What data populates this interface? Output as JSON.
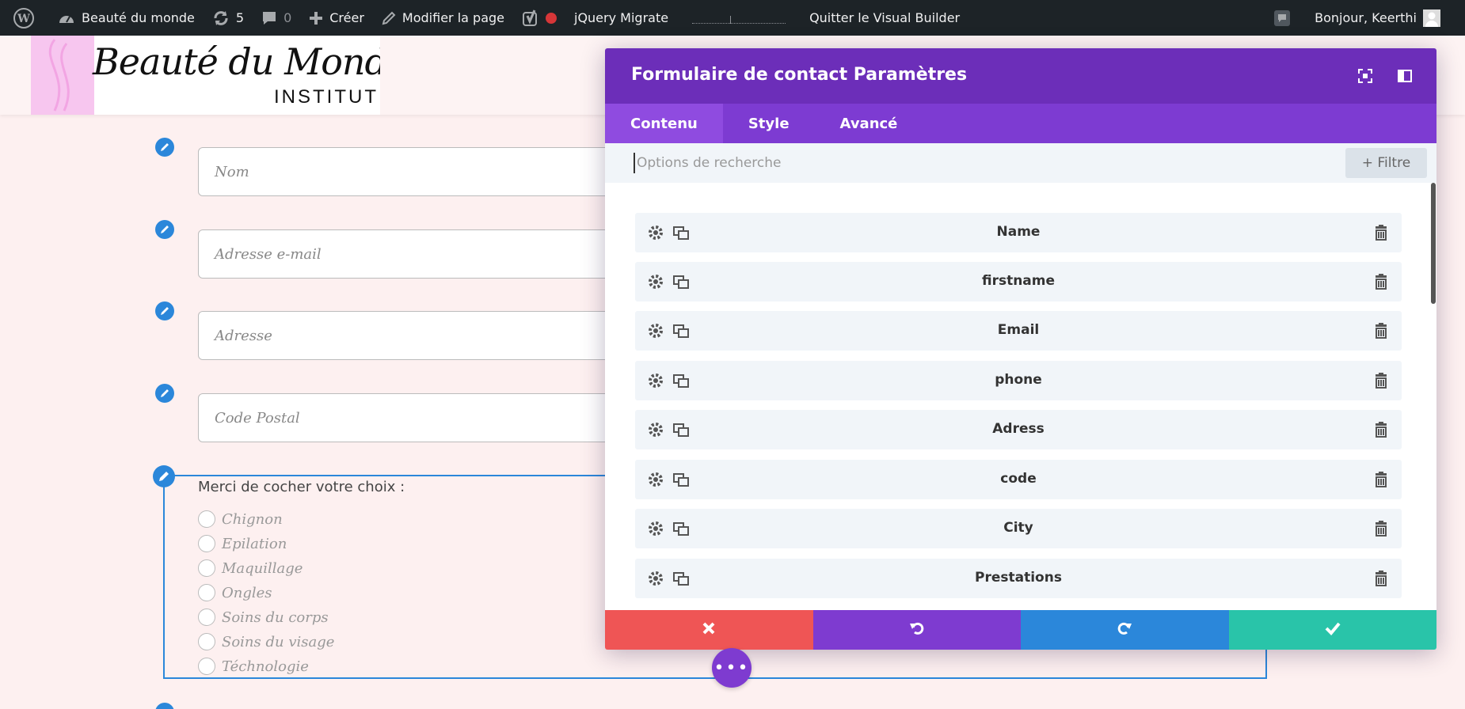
{
  "admin_bar": {
    "site_name": "Beauté du monde",
    "updates_count": "5",
    "comments_count": "0",
    "new_label": "Créer",
    "edit_label": "Modifier la page",
    "jquery_label": "jQuery Migrate",
    "exit_label": "Quitter le Visual Builder",
    "greeting": "Bonjour, Keerthi"
  },
  "logo": {
    "script_text": "Beauté du Monde",
    "sub_text": "INSTITUT"
  },
  "form": {
    "fields": [
      {
        "placeholder": "Nom"
      },
      {
        "placeholder": "Adresse e-mail"
      },
      {
        "placeholder": "Adresse"
      },
      {
        "placeholder": "Code Postal"
      }
    ],
    "choice_title": "Merci de cocher votre choix :",
    "options": [
      "Chignon",
      "Epilation",
      "Maquillage",
      "Ongles",
      "Soins du corps",
      "Soins du visage",
      "Téchnologie"
    ]
  },
  "modal": {
    "title": "Formulaire de contact Paramètres",
    "tabs": [
      "Contenu",
      "Style",
      "Avancé"
    ],
    "active_tab": "Contenu",
    "search_placeholder": "Options de recherche",
    "filter_label": "+ Filtre",
    "fields": [
      "Name",
      "firstname",
      "Email",
      "phone",
      "Adress",
      "code",
      "City",
      "Prestations"
    ]
  },
  "colors": {
    "admin_bg": "#1d2327",
    "modal_header": "#6c2eb9",
    "tabs_bg": "#7d3bd2",
    "cancel": "#ef5555",
    "undo": "#7e3bd0",
    "redo": "#2b87da",
    "save": "#29c4a9"
  }
}
